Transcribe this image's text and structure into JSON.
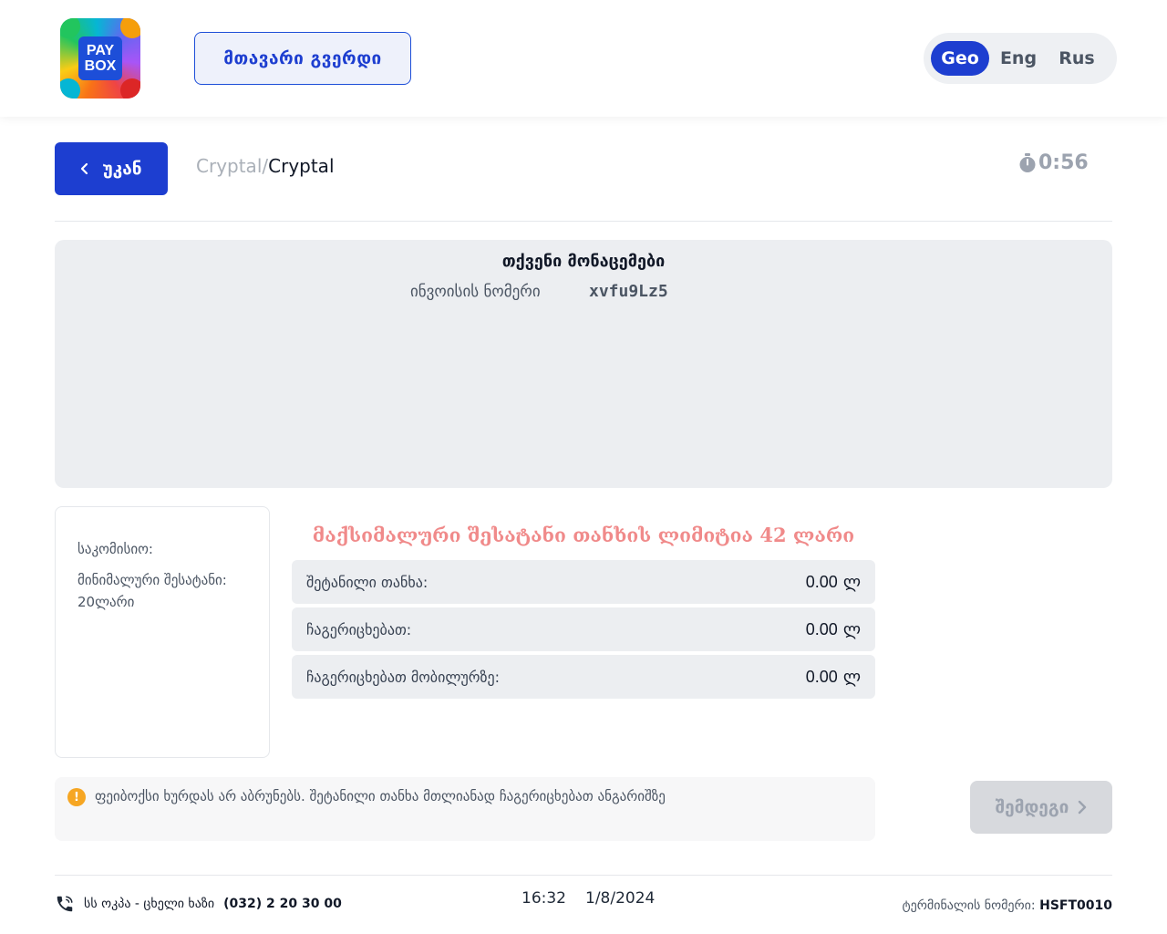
{
  "header": {
    "logo_text": "PAY BOX",
    "home_button": "მთავარი გვერდი",
    "languages": [
      {
        "label": "Geo",
        "active": true
      },
      {
        "label": "Eng",
        "active": false
      },
      {
        "label": "Rus",
        "active": false
      }
    ]
  },
  "nav": {
    "back_label": "უკან",
    "breadcrumb_parent": "Cryptal/",
    "breadcrumb_current": "Cryptal",
    "timer": "0:56"
  },
  "info": {
    "title": "თქვენი მონაცემები",
    "invoice_label": "ინვოისის ნომერი",
    "invoice_value": "xvfu9Lz5"
  },
  "fees": {
    "commission": "საკომისიო:",
    "minimum": "მინიმალური შესატანი: 20ლარი"
  },
  "payment": {
    "limit_text": "მაქსიმალური შესატანი თანხის ლიმიტია 42 ლარი",
    "currency": "ლ",
    "rows": [
      {
        "label": "შეტანილი თანხა:",
        "value": "0.00"
      },
      {
        "label": "ჩაგერიცხებათ:",
        "value": "0.00"
      },
      {
        "label": "ჩაგერიცხებათ მობილურზე:",
        "value": "0.00"
      }
    ]
  },
  "notice": {
    "icon": "!",
    "text": "ფეიბოქსი ხურდას არ აბრუნებს. შეტანილი თანხა მთლიანად ჩაგერიცხებათ ანგარიშზე"
  },
  "next_label": "შემდეგი",
  "footer": {
    "hotline_text": "სს ოკპა - ცხელი ხაზი",
    "hotline_phone": "(032) 2 20 30 00",
    "time": "16:32",
    "date": "1/8/2024",
    "terminal_label": "ტერმინალის ნომერი:",
    "terminal_value": "HSFT0010"
  },
  "colors": {
    "accent": "#1d3ed0",
    "limit_text": "#f08a8a",
    "warning": "#f6a623"
  }
}
